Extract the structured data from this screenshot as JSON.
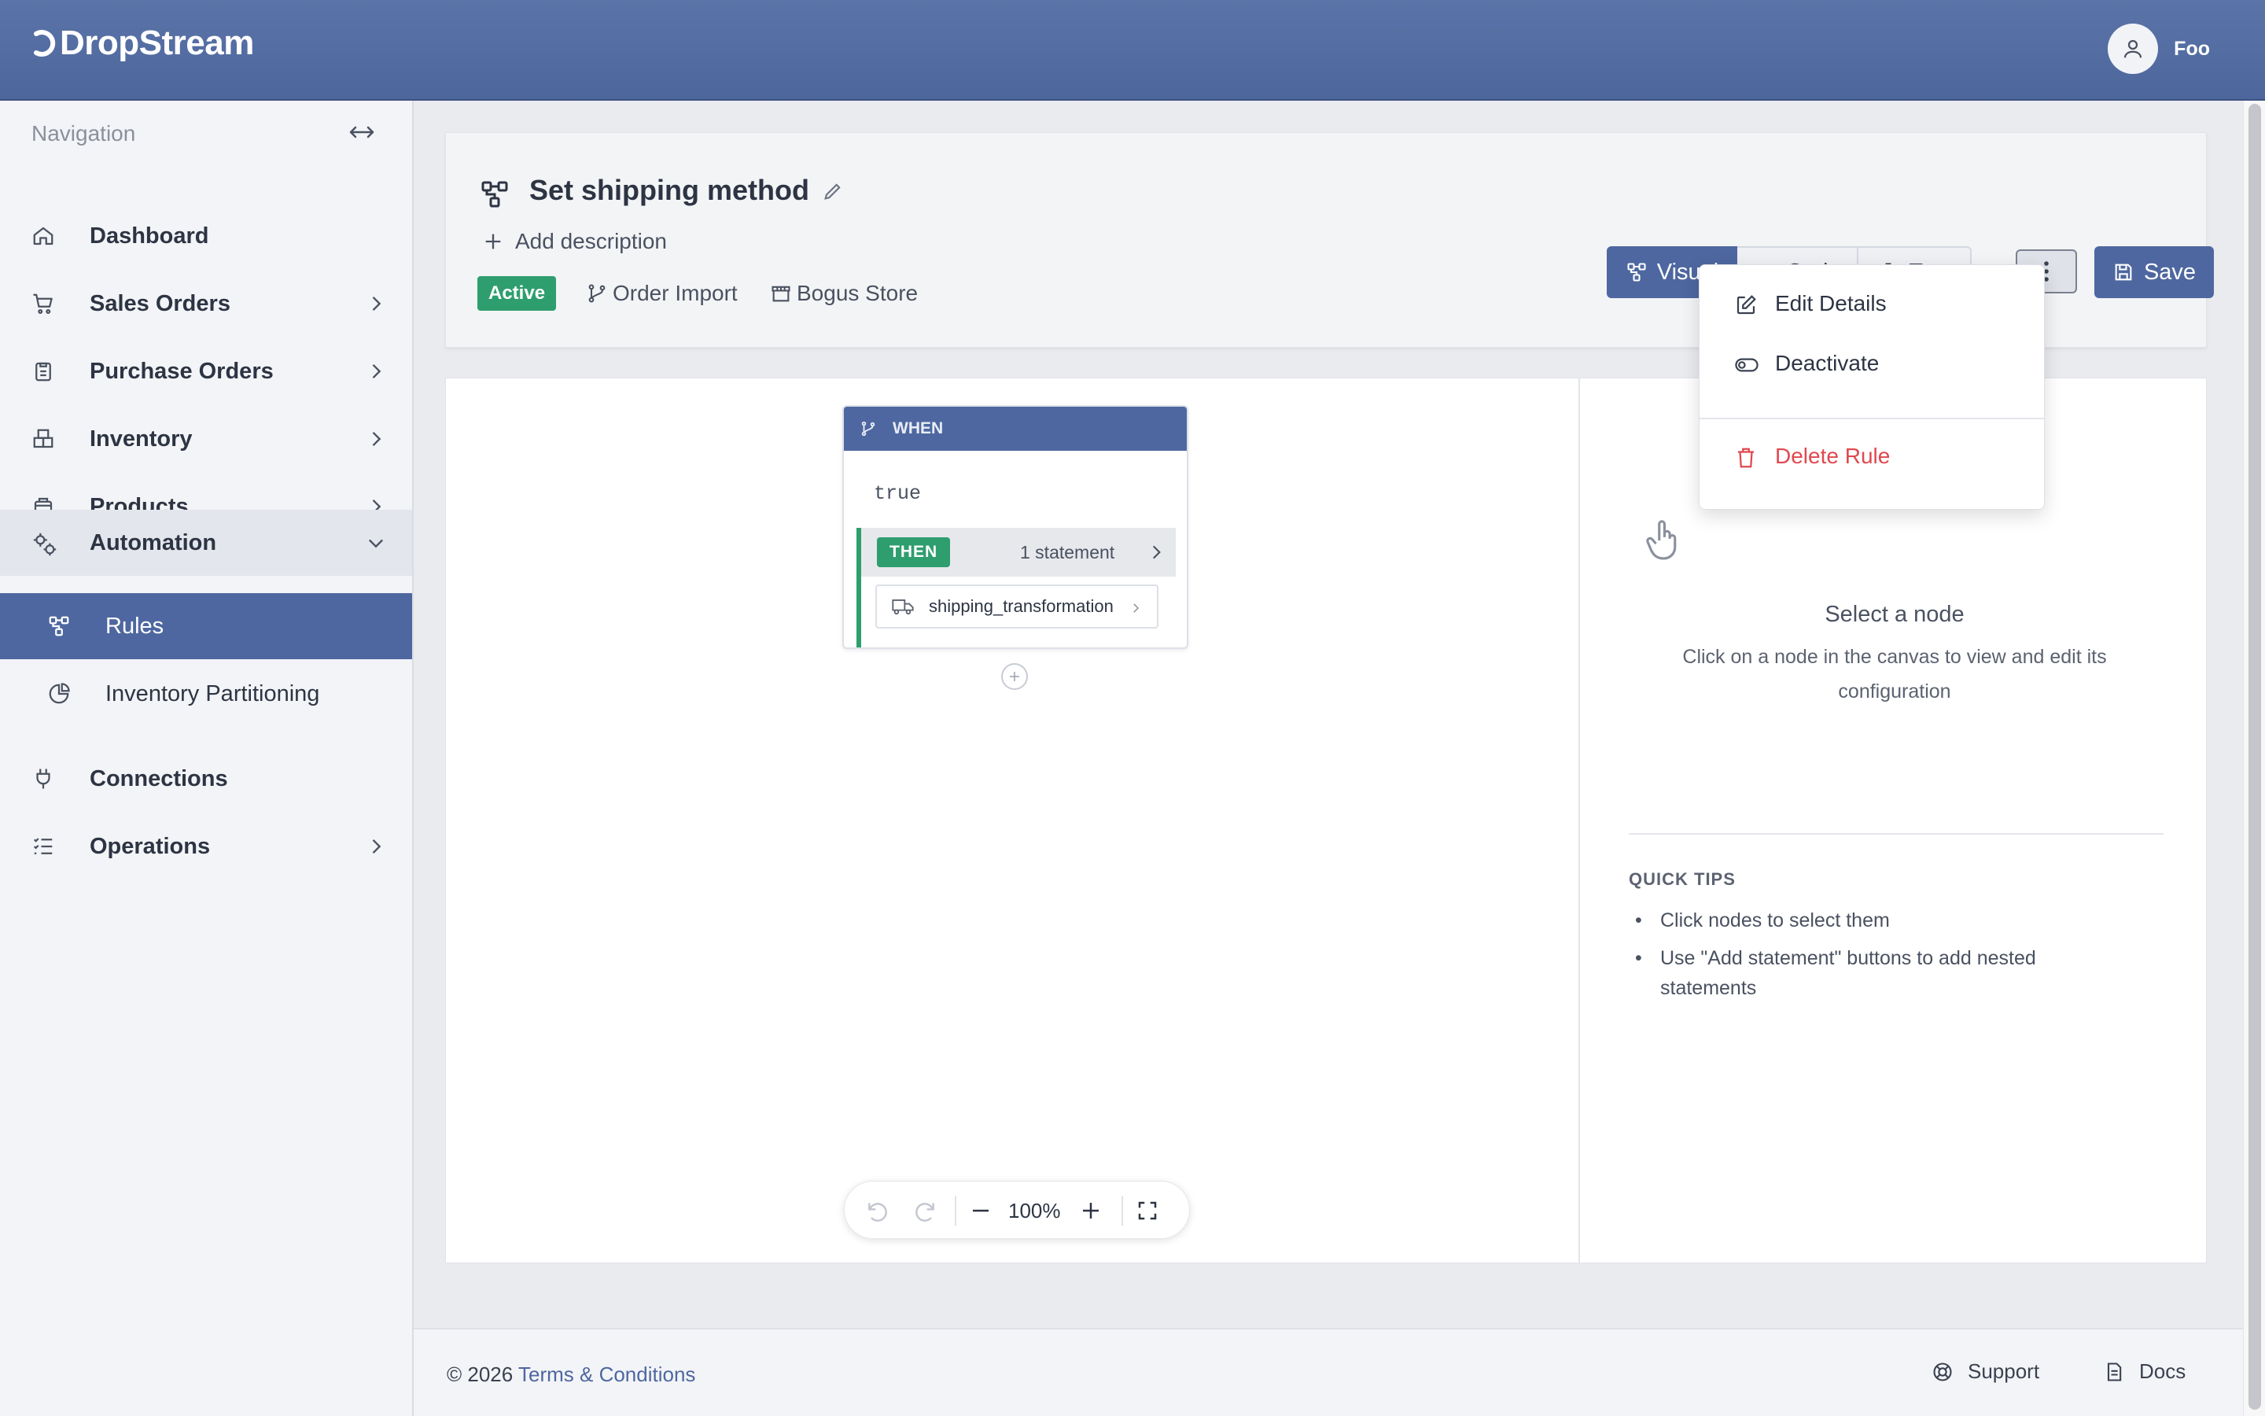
{
  "app": {
    "name": "DropStream"
  },
  "user": {
    "name": "Foo"
  },
  "sidebar": {
    "title": "Navigation",
    "items": [
      {
        "label": "Dashboard"
      },
      {
        "label": "Sales Orders"
      },
      {
        "label": "Purchase Orders"
      },
      {
        "label": "Inventory"
      },
      {
        "label": "Products"
      },
      {
        "label": "Automation"
      },
      {
        "label": "Rules"
      },
      {
        "label": "Inventory Partitioning"
      },
      {
        "label": "Connections"
      },
      {
        "label": "Operations"
      }
    ]
  },
  "rule": {
    "title": "Set shipping method",
    "add_description": "Add description",
    "status": "Active",
    "trigger": "Order Import",
    "store": "Bogus Store"
  },
  "toolbar": {
    "visual": "Visual",
    "code": "Code",
    "test": "Test",
    "save": "Save"
  },
  "menu": {
    "edit": "Edit Details",
    "deactivate": "Deactivate",
    "delete": "Delete Rule"
  },
  "node": {
    "header": "WHEN",
    "condition": "true",
    "then_label": "THEN",
    "then_count": "1 statement",
    "statement": "shipping_transformation"
  },
  "zoom": {
    "level": "100%"
  },
  "panel": {
    "title": "Select a node",
    "description": "Click on a node in the canvas to view and edit its configuration",
    "tips_title": "QUICK TIPS",
    "tips": [
      "Click nodes to select them",
      "Use \"Add statement\" buttons to add nested statements"
    ]
  },
  "footer": {
    "copyright": "© 2026",
    "terms": "Terms & Conditions",
    "support": "Support",
    "docs": "Docs"
  },
  "colors": {
    "brand": "#4e67a0",
    "success": "#2e9e6e",
    "danger": "#e0484f"
  }
}
